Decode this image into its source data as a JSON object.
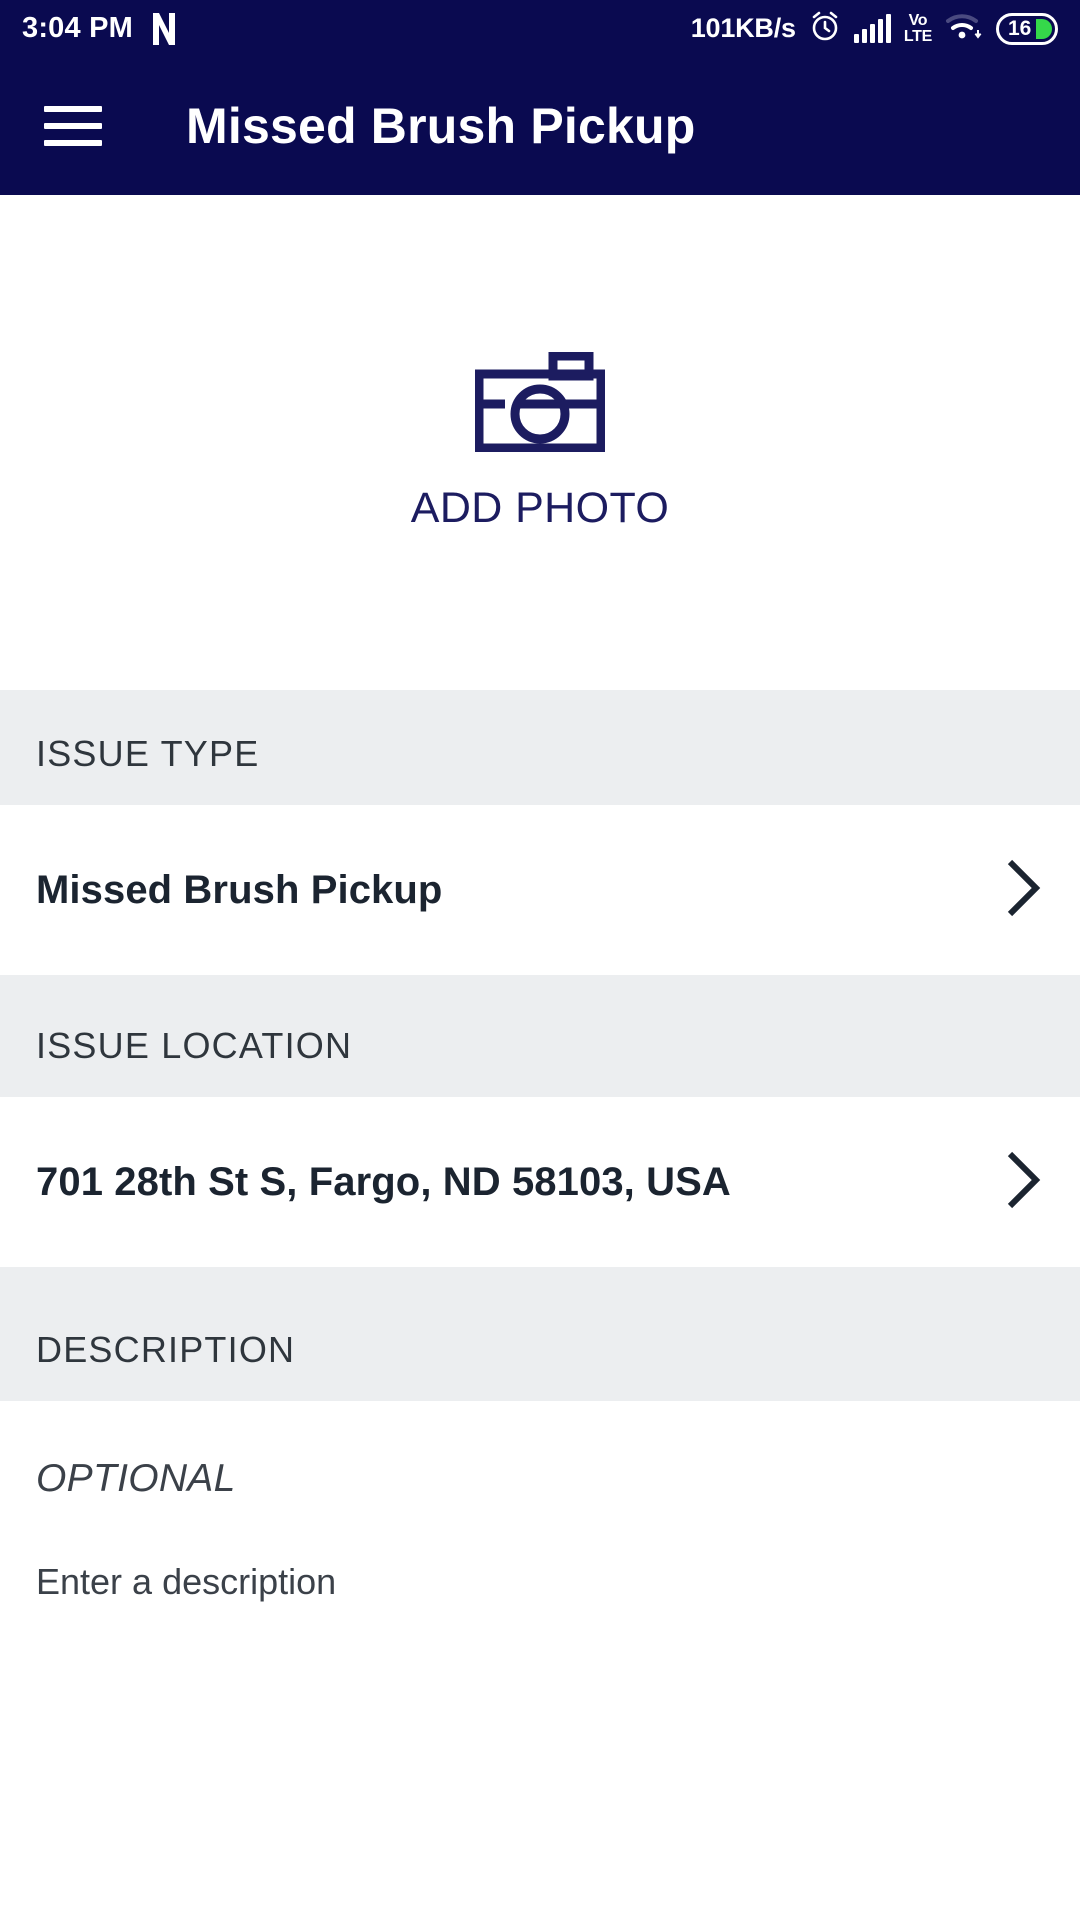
{
  "status_bar": {
    "time": "3:04 PM",
    "app_logo": "netflix-n-logo",
    "network_speed": "101KB/s",
    "alarm_icon": "alarm-clock-icon",
    "signal_icon": "cellular-signal-icon",
    "network_type_top": "Vo",
    "network_type_bottom": "LTE",
    "wifi_icon": "wifi-icon",
    "battery_level": "16",
    "background_color": "#0a0a50",
    "text_color": "#ffffff"
  },
  "app_bar": {
    "menu_icon": "hamburger-menu-icon",
    "title": "Missed Brush Pickup",
    "background_color": "#0a0a50"
  },
  "photo": {
    "icon": "camera-icon",
    "label": "ADD PHOTO",
    "accent_color": "#1c1c60"
  },
  "sections": {
    "issue_type": {
      "header": "ISSUE TYPE",
      "value": "Missed Brush Pickup",
      "chevron": "chevron-right-icon"
    },
    "issue_location": {
      "header": "ISSUE LOCATION",
      "value": "701 28th St S, Fargo, ND 58103, USA",
      "chevron": "chevron-right-icon"
    },
    "description": {
      "header": "DESCRIPTION",
      "optional_label": "OPTIONAL",
      "hint": "Enter a description"
    }
  },
  "colors": {
    "navy": "#0a0a50",
    "section_gray": "#eceef0",
    "body_text": "#1b2430",
    "header_text": "#2f363d",
    "battery_green": "#35d84a"
  }
}
